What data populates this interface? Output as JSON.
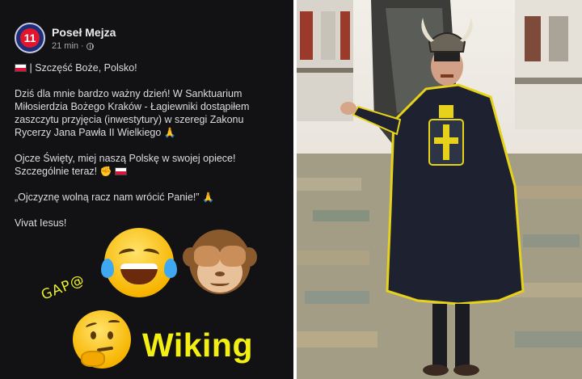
{
  "post": {
    "avatar_text": "11",
    "author": "Poseł Mejza",
    "time": "21 min",
    "separator": "·",
    "greeting": "| Szczęść Boże, Polsko!",
    "paragraph1": "Dziś dla mnie bardzo ważny dzień! W Sanktuarium Miłosierdzia Bożego Kraków - Łagiewniki dostąpiłem zaszczytu przyjęcia (inwestytury) w szeregi Zakonu Rycerzy Jana Pawła II Wielkiego",
    "paragraph1_emoji": "🙏",
    "paragraph2": "Ojcze Święty, miej naszą Polskę w swojej opiece! Szczególnie teraz!",
    "paragraph2_emoji": "✊",
    "quote": "„Ojczyznę wolną racz nam wrócić Panie!”",
    "quote_emoji": "🙏",
    "closing": "Vivat Iesus!"
  },
  "overlay": {
    "tag": "GAP@",
    "caption": "Wiking"
  },
  "colors": {
    "post_background": "#121214",
    "caption_yellow": "#f4ef12",
    "flag_red": "#dc143c",
    "avatar_blue": "#1b2f7a",
    "avatar_red": "#e2152c"
  },
  "icons": [
    "globe-icon",
    "poland-flag-icon",
    "laughing-tears-emoji",
    "see-no-evil-monkey-emoji",
    "thinking-face-emoji"
  ]
}
